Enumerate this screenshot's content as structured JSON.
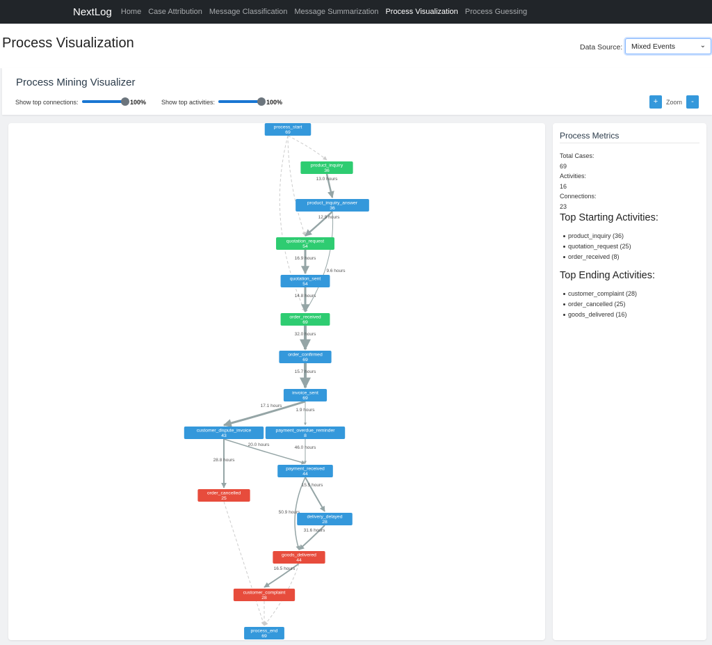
{
  "nav": {
    "brand": "NextLog",
    "links": [
      "Home",
      "Case Attribution",
      "Message Classification",
      "Message Summarization",
      "Process Visualization",
      "Process Guessing"
    ],
    "active_index": 4
  },
  "page": {
    "title": "Process Visualization",
    "data_source_label": "Data Source:",
    "data_source_value": "Mixed Events"
  },
  "visualizer": {
    "title": "Process Mining Visualizer",
    "connections_label": "Show top connections:",
    "connections_value": "100%",
    "connections_fraction": 1.0,
    "activities_label": "Show top activities:",
    "activities_value": "100%",
    "activities_fraction": 1.0,
    "zoom_in": "+",
    "zoom_label": "Zoom",
    "zoom_out": "-"
  },
  "colors": {
    "start_node": "#3498db",
    "normal_node": "#3498db",
    "green_node": "#2ecc71",
    "end_node": "#e74c3c",
    "edge": "#95a5a6"
  },
  "graph": {
    "nodes": [
      {
        "id": "process_start",
        "count": "69",
        "color": "blue"
      },
      {
        "id": "product_inquiry",
        "count": "36",
        "color": "green"
      },
      {
        "id": "product_inquiry_answer",
        "count": "36",
        "color": "blue"
      },
      {
        "id": "quotation_request",
        "count": "54",
        "color": "green"
      },
      {
        "id": "quotation_sent",
        "count": "54",
        "color": "blue"
      },
      {
        "id": "order_received",
        "count": "69",
        "color": "green"
      },
      {
        "id": "order_confirmed",
        "count": "69",
        "color": "blue"
      },
      {
        "id": "invoice_sent",
        "count": "69",
        "color": "blue"
      },
      {
        "id": "customer_dispute_invoice",
        "count": "43",
        "color": "blue"
      },
      {
        "id": "payment_overdue_reminder",
        "count": "8",
        "color": "blue"
      },
      {
        "id": "payment_received",
        "count": "44",
        "color": "blue"
      },
      {
        "id": "order_cancelled",
        "count": "25",
        "color": "red"
      },
      {
        "id": "delivery_delayed",
        "count": "28",
        "color": "blue"
      },
      {
        "id": "goods_delivered",
        "count": "44",
        "color": "red"
      },
      {
        "id": "customer_complaint",
        "count": "28",
        "color": "red"
      },
      {
        "id": "process_end",
        "count": "69",
        "color": "blue"
      }
    ],
    "edge_labels": [
      "13.0 hours",
      "12.9 hours",
      "16.9 hours",
      "9.6 hours",
      "14.8 hours",
      "32.0 hours",
      "15.7 hours",
      "17.1 hours",
      "1.9 hours",
      "20.0 hours",
      "28.8 hours",
      "46.0 hours",
      "15.5 hours",
      "50.9 hours",
      "31.6 hours",
      "16.5 hours"
    ]
  },
  "metrics": {
    "title": "Process Metrics",
    "total_cases_label": "Total Cases:",
    "total_cases": "69",
    "activities_label": "Activities:",
    "activities": "16",
    "connections_label": "Connections:",
    "connections": "23",
    "starting_title": "Top Starting Activities:",
    "starting": [
      "product_inquiry (36)",
      "quotation_request (25)",
      "order_received (8)"
    ],
    "ending_title": "Top Ending Activities:",
    "ending": [
      "customer_complaint (28)",
      "order_cancelled (25)",
      "goods_delivered (16)"
    ]
  }
}
